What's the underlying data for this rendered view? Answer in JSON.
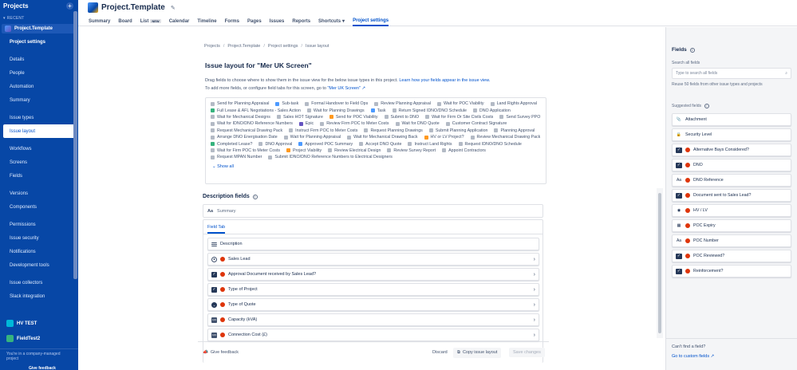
{
  "sidebar": {
    "title": "Projects",
    "recent_label": "RECENT",
    "current_project": "Project.Template",
    "items": [
      {
        "label": "Project settings",
        "bold": true
      },
      {
        "label": "Details"
      },
      {
        "label": "People"
      },
      {
        "label": "Automation"
      },
      {
        "label": "Summary"
      },
      {
        "label": "Issue types"
      },
      {
        "label": "Issue layout",
        "active": true
      },
      {
        "label": "Workflows"
      },
      {
        "label": "Screens"
      },
      {
        "label": "Fields"
      },
      {
        "label": "Versions"
      },
      {
        "label": "Components"
      },
      {
        "label": "Permissions"
      },
      {
        "label": "Issue security"
      },
      {
        "label": "Notifications"
      },
      {
        "label": "Development tools"
      },
      {
        "label": "Issue collectors"
      },
      {
        "label": "Slack integration"
      }
    ],
    "other_projects": [
      "HV TEST",
      "FieldTest2"
    ],
    "footer_text": "You're in a company-managed project",
    "feedback": "Give feedback"
  },
  "header": {
    "project_title": "Project.Template",
    "tabs": [
      {
        "label": "Summary"
      },
      {
        "label": "Board"
      },
      {
        "label": "List",
        "badge": "NEW"
      },
      {
        "label": "Calendar"
      },
      {
        "label": "Timeline"
      },
      {
        "label": "Forms"
      },
      {
        "label": "Pages"
      },
      {
        "label": "Issues"
      },
      {
        "label": "Reports"
      },
      {
        "label": "Shortcuts",
        "dropdown": true
      },
      {
        "label": "Project settings",
        "active": true
      }
    ]
  },
  "main": {
    "breadcrumbs": [
      "Projects",
      "Project.Template",
      "Project settings",
      "Issue layout"
    ],
    "title": "Issue layout for \"Mer UK Screen\"",
    "desc_line1": "Drag fields to choose where to show them in the issue view for the below issue types in this project.",
    "desc_link1": "Learn how your fields appear in the issue view.",
    "desc_line2": "To add more fields, or configure field tabs for this screen, go to",
    "desc_link2": "\"Mer UK Screen\"",
    "issue_types": [
      {
        "label": "Send for Planning Appraisal",
        "c": "grey"
      },
      {
        "label": "Sub-task",
        "c": "blue"
      },
      {
        "label": "Formal Handover to Field Ops",
        "c": "grey"
      },
      {
        "label": "Review Planning Appraisal",
        "c": "grey"
      },
      {
        "label": "Wait for POC Viability",
        "c": "grey"
      },
      {
        "label": "Land Rights Approval",
        "c": "grey"
      },
      {
        "label": "Full Lease & AFL Negotiations - Sales Action",
        "c": "green"
      },
      {
        "label": "Wait for Planning Drawings",
        "c": "grey"
      },
      {
        "label": "Task",
        "c": "blue"
      },
      {
        "label": "Return Signed IDNO/DNO Schedule",
        "c": "grey"
      },
      {
        "label": "DNO Application",
        "c": "grey"
      },
      {
        "label": "Wait for Mechanical Designs",
        "c": "grey"
      },
      {
        "label": "Sales HOT Signature",
        "c": "grey"
      },
      {
        "label": "Send for POC Viability",
        "c": "orange"
      },
      {
        "label": "Submit to DNO",
        "c": "grey"
      },
      {
        "label": "Wait for Firm Or Site Civils Costs",
        "c": "grey"
      },
      {
        "label": "Send Survey PPO",
        "c": "grey"
      },
      {
        "label": "Wait for IDNO/DNO Reference Numbers",
        "c": "grey"
      },
      {
        "label": "Epic",
        "c": "purple"
      },
      {
        "label": "Review Firm POC to Meter Costs",
        "c": "grey"
      },
      {
        "label": "Wait for DNO Quote",
        "c": "grey"
      },
      {
        "label": "Customer Contract Signature",
        "c": "grey"
      },
      {
        "label": "Request Mechanical Drawing Pack",
        "c": "grey"
      },
      {
        "label": "Instruct Firm POC to Meter Costs",
        "c": "grey"
      },
      {
        "label": "Request Planning Drawings",
        "c": "grey"
      },
      {
        "label": "Submit Planning Application",
        "c": "grey"
      },
      {
        "label": "Planning Approval",
        "c": "grey"
      },
      {
        "label": "Arrange DNO Energisation Date",
        "c": "grey"
      },
      {
        "label": "Wait for Planning Appraisal",
        "c": "grey"
      },
      {
        "label": "Wait for Mechanical Drawing Back",
        "c": "grey"
      },
      {
        "label": "HV or LV Project?",
        "c": "orange"
      },
      {
        "label": "Review Mechanical Drawing Pack",
        "c": "grey"
      },
      {
        "label": "Completed Lease?",
        "c": "green"
      },
      {
        "label": "DNO Approval",
        "c": "grey"
      },
      {
        "label": "Approved POC Summary",
        "c": "blue"
      },
      {
        "label": "Accept DNO Quote",
        "c": "grey"
      },
      {
        "label": "Instruct Land Rights",
        "c": "grey"
      },
      {
        "label": "Request IDNO/DNO Schedule",
        "c": "grey"
      },
      {
        "label": "Wait for Firm POC to Meter Costs",
        "c": "grey"
      },
      {
        "label": "Project Viability",
        "c": "orange"
      },
      {
        "label": "Review Electrical Design",
        "c": "grey"
      },
      {
        "label": "Review Survey Report",
        "c": "grey"
      },
      {
        "label": "Appoint Contractors",
        "c": "grey"
      },
      {
        "label": "Request MPAN Number",
        "c": "grey"
      },
      {
        "label": "Submit IDNO/DNO Reference Numbers to Electrical Designers",
        "c": "grey"
      }
    ],
    "show_all": "Show all",
    "description_fields_title": "Description fields",
    "summary_label": "Summary",
    "field_tab_label": "Field Tab",
    "field_rows": [
      {
        "label": "Description",
        "icon": "lines",
        "required": false
      },
      {
        "label": "Sales Lead",
        "icon": "user",
        "required": true
      },
      {
        "label": "Approval Document received by Sales Lead?",
        "icon": "check",
        "required": true
      },
      {
        "label": "Type of Project",
        "icon": "check",
        "required": true
      },
      {
        "label": "Type of Quote",
        "icon": "dd",
        "required": true
      },
      {
        "label": "Capacity (kVA)",
        "icon": "num",
        "required": true
      },
      {
        "label": "Connection Cost (£)",
        "icon": "num",
        "required": true
      }
    ],
    "give_feedback": "Give feedback",
    "discard": "Discard",
    "copy_layout": "Copy issue layout",
    "save_changes": "Save changes"
  },
  "right_panel": {
    "title": "Fields",
    "search_label": "Search all fields",
    "search_placeholder": "Type to search all fields",
    "reuse_hint": "Reuse 50 fields from other issue types and projects",
    "suggested_label": "Suggested fields",
    "fields": [
      {
        "label": "Attachment",
        "icon": "clip",
        "required": false
      },
      {
        "label": "Security Level",
        "icon": "lock",
        "required": false
      },
      {
        "label": "Alternative Bays Considered?",
        "icon": "check",
        "required": true
      },
      {
        "label": "DNO",
        "icon": "check",
        "required": true
      },
      {
        "label": "DNO Reference",
        "icon": "aa",
        "required": true
      },
      {
        "label": "Document sent to Sales Lead?",
        "icon": "check",
        "required": true
      },
      {
        "label": "HV / LV",
        "icon": "radio",
        "required": true
      },
      {
        "label": "POC Expiry",
        "icon": "cal",
        "required": true
      },
      {
        "label": "POC Number",
        "icon": "aa",
        "required": true
      },
      {
        "label": "POC Reviewed?",
        "icon": "check",
        "required": true
      },
      {
        "label": "Reinforcement?",
        "icon": "check",
        "required": true
      }
    ],
    "cant_find": "Can't find a field?",
    "custom_link": "Go to custom fields"
  },
  "colors": {
    "sidebar_bg": "#0747a6",
    "accent": "#0052cc",
    "required_dot": "#de350b"
  }
}
